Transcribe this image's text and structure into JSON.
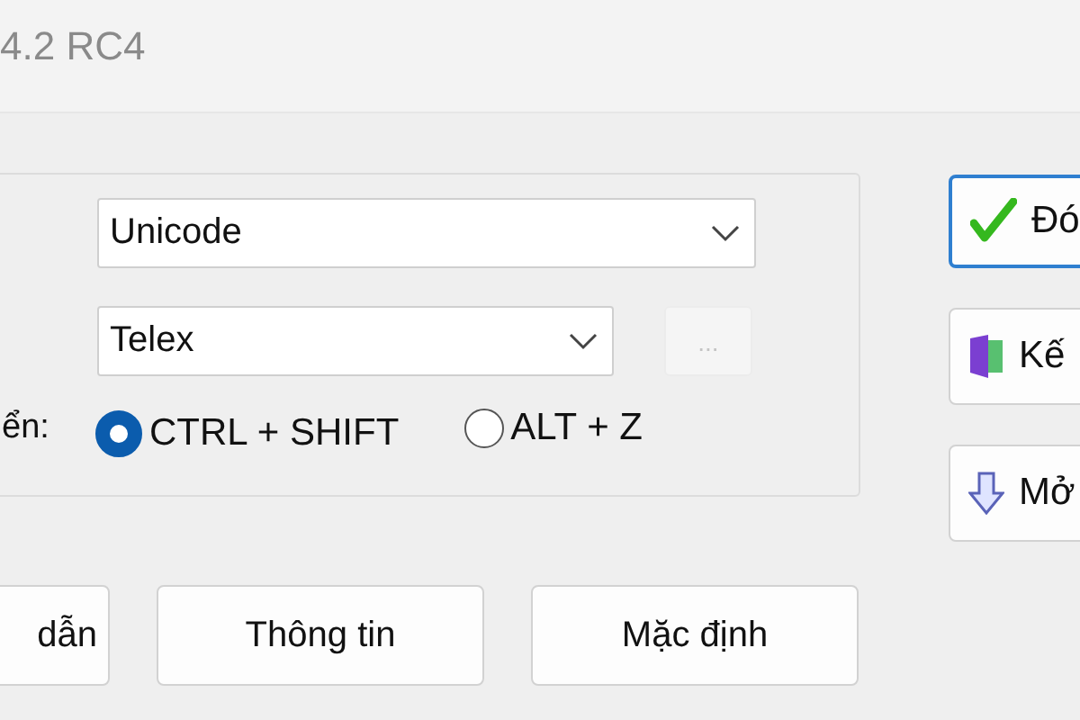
{
  "window": {
    "title": "4.2 RC4"
  },
  "charset": {
    "value": "Unicode"
  },
  "input_method": {
    "value": "Telex",
    "more_button": "..."
  },
  "switch_key": {
    "label": "ển:",
    "options": [
      {
        "label": "CTRL + SHIFT",
        "selected": true
      },
      {
        "label": "ALT + Z",
        "selected": false
      }
    ]
  },
  "side_buttons": [
    {
      "label": "Đó",
      "kind": "check",
      "focused": true
    },
    {
      "label": "Kế",
      "kind": "door",
      "focused": false
    },
    {
      "label": "Mở",
      "kind": "down",
      "focused": false
    }
  ],
  "bottom_buttons": [
    "dẫn",
    "Thông tin",
    "Mặc định"
  ]
}
